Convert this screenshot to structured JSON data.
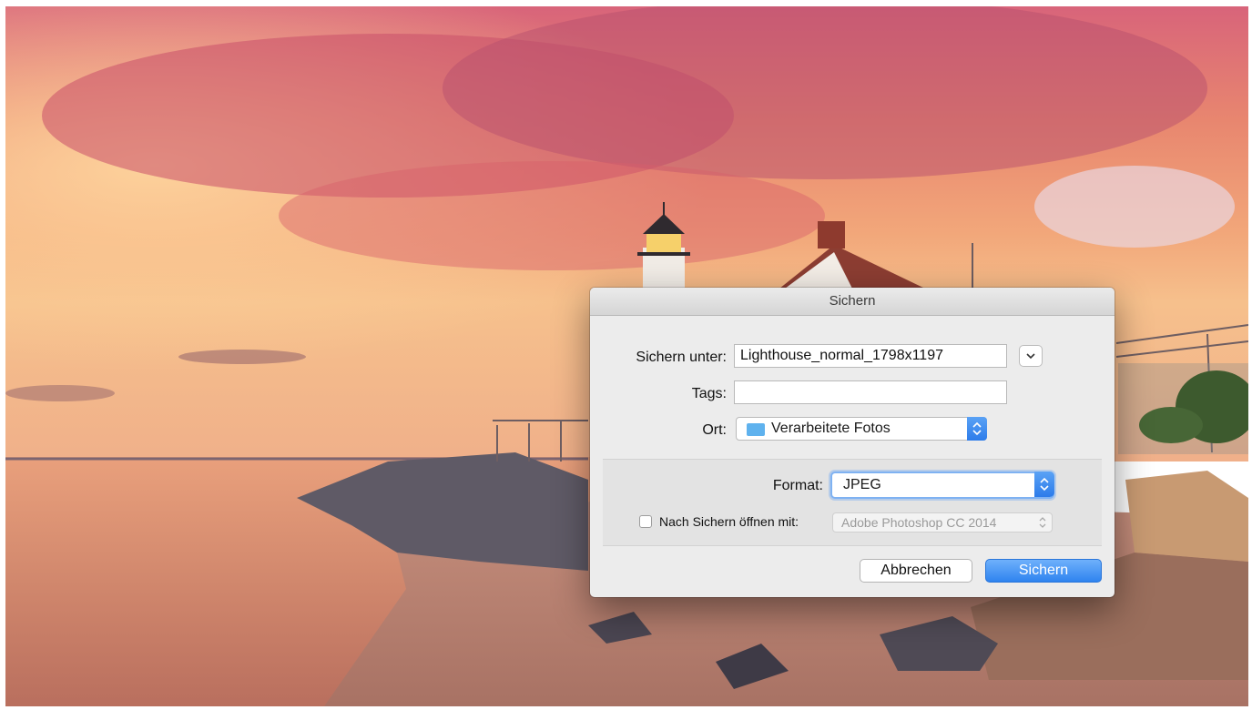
{
  "dialog": {
    "title": "Sichern",
    "save_as_label": "Sichern unter:",
    "save_as_value": "Lighthouse_normal_1798x1197",
    "tags_label": "Tags:",
    "tags_value": "",
    "location_label": "Ort:",
    "location_value": "Verarbeitete Fotos",
    "location_icon": "folder-icon",
    "format_label": "Format:",
    "format_value": "JPEG",
    "open_after_save_label": "Nach Sichern öffnen mit:",
    "open_after_save_checked": false,
    "open_with_app": "Adobe Photoshop CC 2014",
    "cancel_label": "Abbrechen",
    "save_label": "Sichern",
    "accent_color": "#2f83ef"
  }
}
